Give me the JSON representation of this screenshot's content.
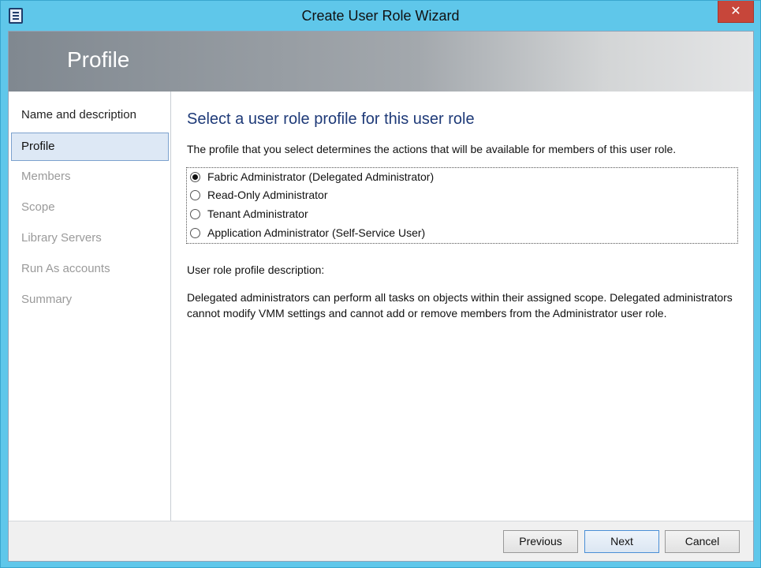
{
  "window": {
    "title": "Create User Role Wizard",
    "close_glyph": "✕",
    "icon": "wizard-app-icon"
  },
  "banner": {
    "title": "Profile"
  },
  "nav": {
    "items": [
      {
        "label": "Name and description",
        "state": "done"
      },
      {
        "label": "Profile",
        "state": "active"
      },
      {
        "label": "Members",
        "state": "pending"
      },
      {
        "label": "Scope",
        "state": "pending"
      },
      {
        "label": "Library Servers",
        "state": "pending"
      },
      {
        "label": "Run As accounts",
        "state": "pending"
      },
      {
        "label": "Summary",
        "state": "pending"
      }
    ]
  },
  "main": {
    "heading": "Select a user role profile for this user role",
    "intro": "The profile that you select determines the actions that will be available for members of this user role.",
    "options": [
      {
        "label": "Fabric Administrator (Delegated Administrator)",
        "checked": true
      },
      {
        "label": "Read-Only Administrator",
        "checked": false
      },
      {
        "label": "Tenant Administrator",
        "checked": false
      },
      {
        "label": "Application Administrator (Self-Service User)",
        "checked": false
      }
    ],
    "description_label": "User role profile description:",
    "description_text": "Delegated administrators can perform all tasks on objects within their assigned scope. Delegated administrators cannot modify VMM settings and cannot add or remove members from the Administrator user role."
  },
  "footer": {
    "previous_label": "Previous",
    "next_label": "Next",
    "cancel_label": "Cancel"
  },
  "colors": {
    "titlebar": "#5fc7ea",
    "close_button": "#c7463a",
    "heading": "#1e3a78",
    "nav_active_bg": "#dde8f5"
  }
}
